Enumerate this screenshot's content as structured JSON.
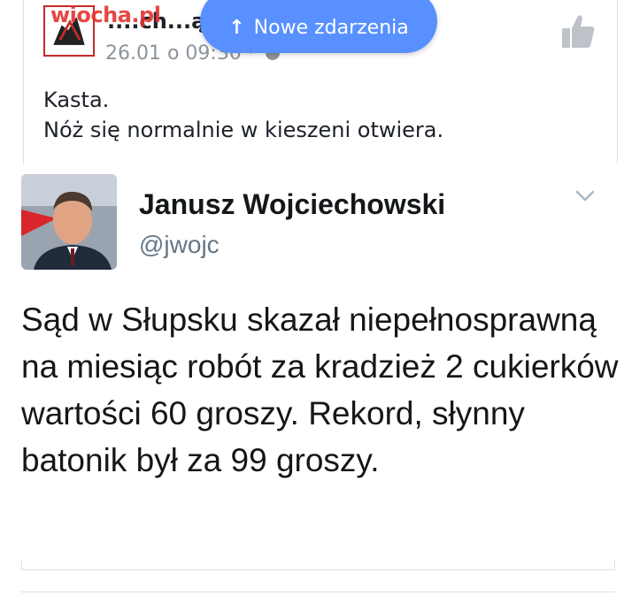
{
  "facebook_post": {
    "author": "....ch...ądy",
    "watermark": "wiocha.pl",
    "meta": "26.01 o 09:30 ·",
    "text_lines": [
      "Kasta.",
      "Nóż się normalnie w kieszeni otwiera."
    ],
    "like_icon": "thumbs-up-icon",
    "globe_icon": "globe-icon"
  },
  "notification": {
    "label": "Nowe zdarzenia",
    "arrow": "↑",
    "color": "#5890ff"
  },
  "tweet": {
    "name": "Janusz Wojciechowski",
    "handle": "@jwojc",
    "text": "Sąd w Słupsku skazał niepełnosprawną na miesiąc robót za kradzież 2 cukierków wartości 60 groszy. Rekord, słynny batonik był za 99 groszy.",
    "chevron_icon": "chevron-down-icon"
  }
}
